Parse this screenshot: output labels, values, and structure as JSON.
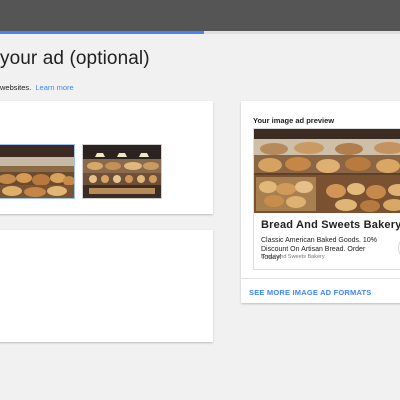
{
  "header": {
    "progress_fraction": 0.51
  },
  "page": {
    "title": "your ad (optional)",
    "intro_text": "websites.",
    "learn_more": "Learn more"
  },
  "images": [
    {
      "name": "bakery-image-1",
      "selected": true
    },
    {
      "name": "bakery-image-2",
      "selected": false
    }
  ],
  "preview": {
    "heading": "Your image ad preview",
    "headline": "Bread And Sweets Bakery",
    "description": "Classic American Baked Goods. 10% Discount On Artisan Bread. Order Today!",
    "display_url": "Bread and Sweets Bakery",
    "next_icon": "chevron-right-icon",
    "more_formats": "SEE MORE IMAGE AD FORMATS"
  },
  "colors": {
    "accent": "#4285f4",
    "topbar": "#555555",
    "background": "#f1f1f1"
  }
}
